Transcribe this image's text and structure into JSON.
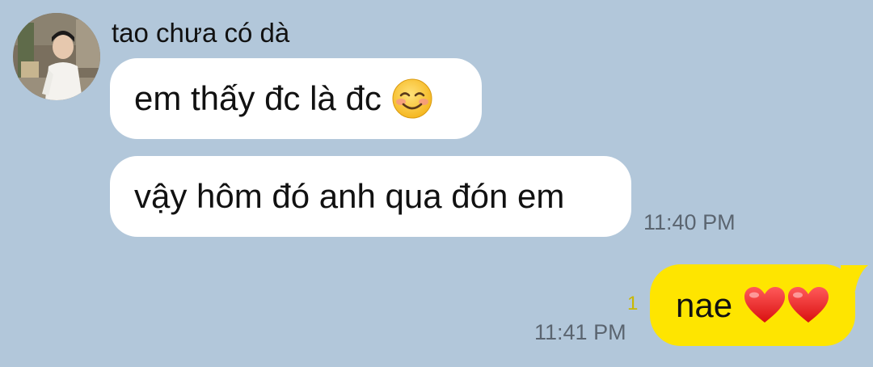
{
  "conversation": {
    "sender_name": "tao chưa có dà",
    "messages": [
      {
        "direction": "incoming",
        "text": "em thấy đc là đc",
        "emoji": "smiling-face-with-blush-icon"
      },
      {
        "direction": "incoming",
        "text": "vậy hôm đó anh qua đón em",
        "time": "11:40 PM"
      },
      {
        "direction": "outgoing",
        "text": "nae",
        "emoji": "red-heart-icon x2",
        "unread_count": "1",
        "time": "11:41 PM"
      }
    ]
  },
  "colors": {
    "background": "#b2c7da",
    "incoming_bubble": "#ffffff",
    "outgoing_bubble": "#fee500",
    "timestamp": "#5b6570",
    "unread_count": "#c9b800"
  }
}
